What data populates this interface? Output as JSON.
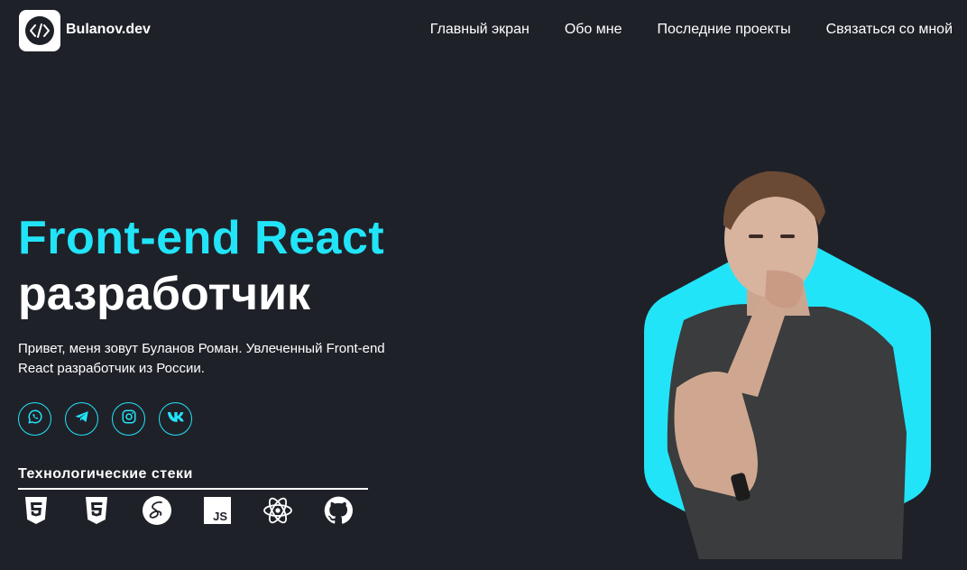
{
  "header": {
    "brand": "Bulanov.dev",
    "logo_icon": "code-brackets-icon",
    "nav": [
      {
        "label": "Главный экран"
      },
      {
        "label": "Обо мне"
      },
      {
        "label": "Последние проекты"
      },
      {
        "label": "Связаться со мной"
      }
    ]
  },
  "hero": {
    "title_line1": "Front-end React",
    "title_line2": "разработчик",
    "intro": "Привет, меня зовут Буланов Роман. Увлеченный Front-end React разработчик из России."
  },
  "socials": [
    {
      "icon": "whatsapp-icon"
    },
    {
      "icon": "telegram-icon"
    },
    {
      "icon": "instagram-icon"
    },
    {
      "icon": "vk-icon"
    }
  ],
  "stack": {
    "title": "Технологические стеки",
    "items": [
      {
        "icon": "html5-icon"
      },
      {
        "icon": "css3-icon"
      },
      {
        "icon": "sass-icon"
      },
      {
        "icon": "javascript-icon",
        "text": "JS"
      },
      {
        "icon": "react-icon"
      },
      {
        "icon": "github-icon"
      }
    ]
  },
  "colors": {
    "background": "#1f2129",
    "accent": "#22e4f8",
    "text": "#ffffff"
  }
}
